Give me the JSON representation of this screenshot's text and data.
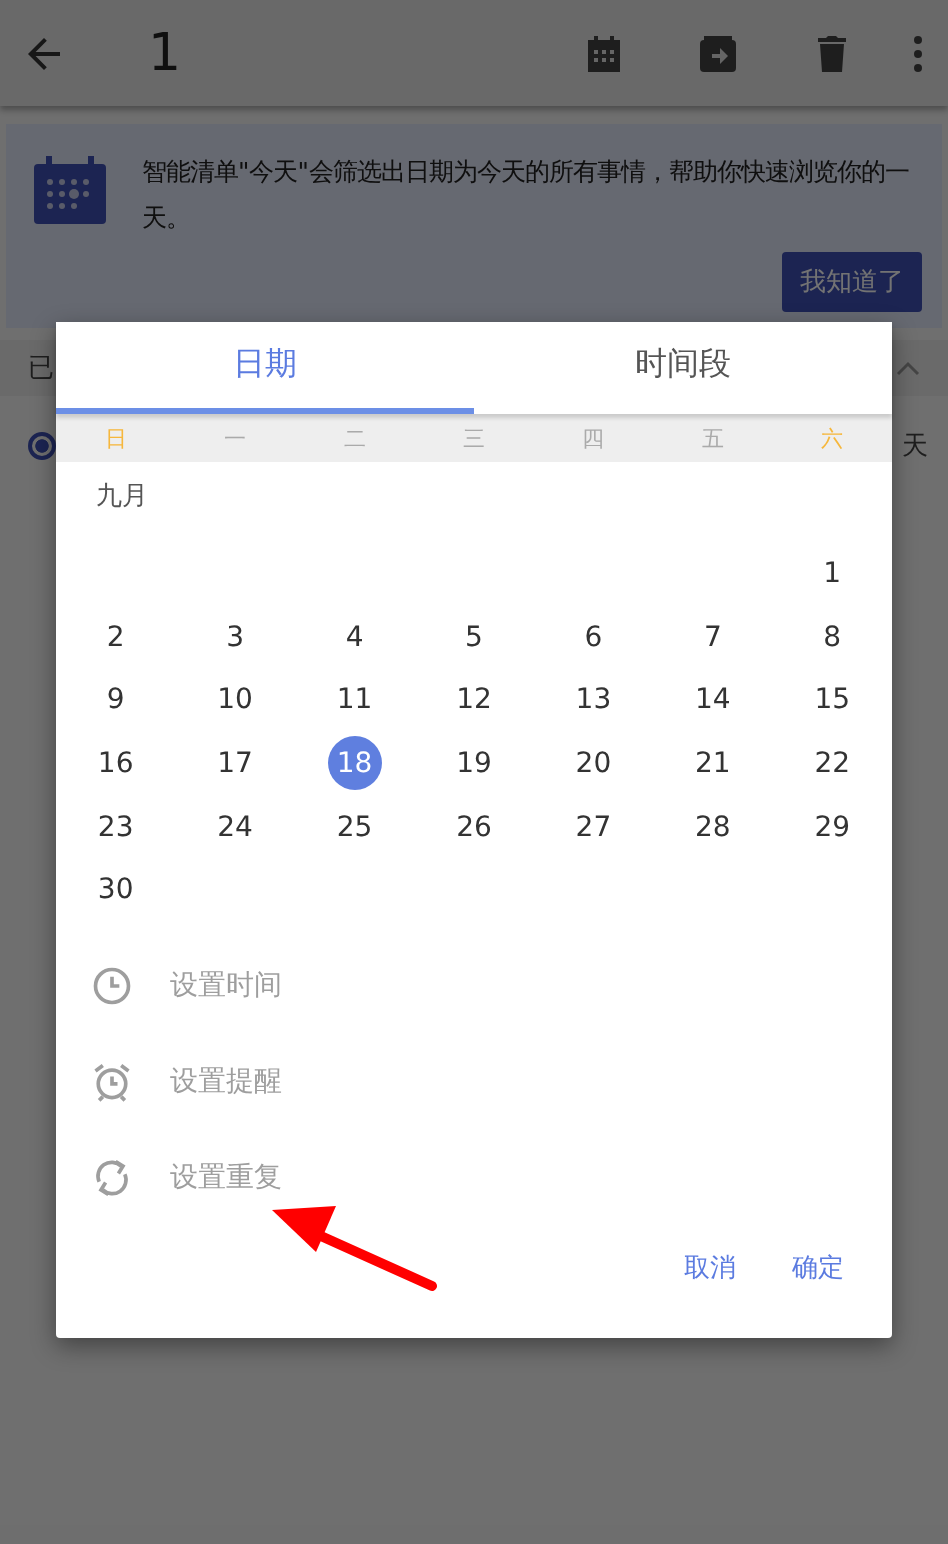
{
  "toolbar": {
    "title": "1"
  },
  "banner": {
    "text": "智能清单\"今天\"会筛选出日期为今天的所有事情，帮助你快速浏览你的一天。",
    "button": "我知道了"
  },
  "section": {
    "label": "已",
    "expanded": true
  },
  "task": {
    "label": "天",
    "selected": true
  },
  "dialog": {
    "tabs": [
      {
        "label": "日期",
        "selected": true
      },
      {
        "label": "时间段",
        "selected": false
      }
    ],
    "weekdays": [
      {
        "label": "日",
        "weekend": true
      },
      {
        "label": "一",
        "weekend": false
      },
      {
        "label": "二",
        "weekend": false
      },
      {
        "label": "三",
        "weekend": false
      },
      {
        "label": "四",
        "weekend": false
      },
      {
        "label": "五",
        "weekend": false
      },
      {
        "label": "六",
        "weekend": true
      }
    ],
    "month": "九月",
    "weeks": [
      {
        "kind": "first",
        "days": [
          {
            "label": "1",
            "selected": false
          }
        ]
      },
      {
        "kind": "full",
        "days": [
          {
            "label": "2",
            "selected": false
          },
          {
            "label": "3",
            "selected": false
          },
          {
            "label": "4",
            "selected": false
          },
          {
            "label": "5",
            "selected": false
          },
          {
            "label": "6",
            "selected": false
          },
          {
            "label": "7",
            "selected": false
          },
          {
            "label": "8",
            "selected": false
          }
        ]
      },
      {
        "kind": "full",
        "days": [
          {
            "label": "9",
            "selected": false
          },
          {
            "label": "10",
            "selected": false
          },
          {
            "label": "11",
            "selected": false
          },
          {
            "label": "12",
            "selected": false
          },
          {
            "label": "13",
            "selected": false
          },
          {
            "label": "14",
            "selected": false
          },
          {
            "label": "15",
            "selected": false
          }
        ]
      },
      {
        "kind": "full",
        "days": [
          {
            "label": "16",
            "selected": false
          },
          {
            "label": "17",
            "selected": false
          },
          {
            "label": "18",
            "selected": true
          },
          {
            "label": "19",
            "selected": false
          },
          {
            "label": "20",
            "selected": false
          },
          {
            "label": "21",
            "selected": false
          },
          {
            "label": "22",
            "selected": false
          }
        ]
      },
      {
        "kind": "full",
        "days": [
          {
            "label": "23",
            "selected": false
          },
          {
            "label": "24",
            "selected": false
          },
          {
            "label": "25",
            "selected": false
          },
          {
            "label": "26",
            "selected": false
          },
          {
            "label": "27",
            "selected": false
          },
          {
            "label": "28",
            "selected": false
          },
          {
            "label": "29",
            "selected": false
          }
        ]
      },
      {
        "kind": "last",
        "days": [
          {
            "label": "30",
            "selected": false
          }
        ]
      }
    ],
    "options": [
      {
        "kind": "time",
        "label": "设置时间"
      },
      {
        "kind": "reminder",
        "label": "设置提醒"
      },
      {
        "kind": "repeat",
        "label": "设置重复"
      }
    ],
    "buttons": [
      "取消",
      "确定"
    ]
  }
}
